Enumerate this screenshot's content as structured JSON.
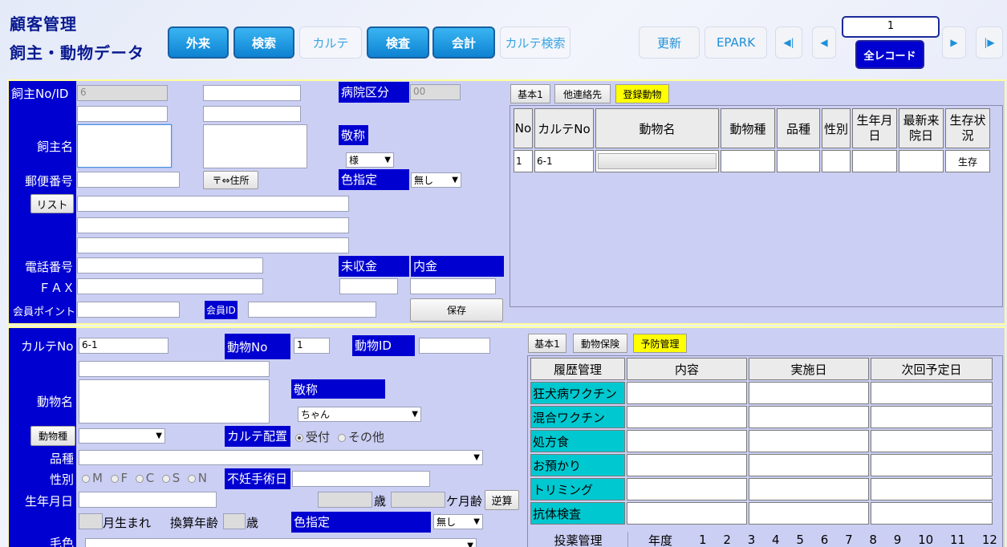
{
  "header": {
    "title1": "顧客管理",
    "title2": "飼主・動物データ"
  },
  "nav": [
    {
      "label": "外来",
      "style": "blue"
    },
    {
      "label": "検索",
      "style": "blue"
    },
    {
      "label": "カルテ",
      "style": "light"
    },
    {
      "label": "検査",
      "style": "blue"
    },
    {
      "label": "会計",
      "style": "blue"
    },
    {
      "label": "カルテ検索",
      "style": "light"
    }
  ],
  "topright": {
    "update": "更新",
    "epark": "EPARK",
    "first": "◀|",
    "prev": "◀",
    "record": "1",
    "next": "▶",
    "last": "|▶",
    "all_records": "全レコード"
  },
  "owner": {
    "labels": {
      "id": "飼主No/ID",
      "name": "飼主名",
      "zip": "郵便番号",
      "list": "リスト",
      "tel": "電話番号",
      "fax": "ＦＡＸ",
      "points": "会員ポイント",
      "member_id": "会員ID",
      "hospital": "病院区分",
      "title": "敬称",
      "color": "色指定",
      "unpaid": "未収金",
      "deposit": "内金",
      "zip_btn": "〒⇔住所",
      "save": "保存"
    },
    "values": {
      "id": "6",
      "hospital": "00",
      "title": "様",
      "color": "無し"
    },
    "tabs": [
      "基本1",
      "他連絡先",
      "登録動物"
    ],
    "animal_table": {
      "headers": [
        "No",
        "カルテNo",
        "動物名",
        "動物種",
        "品種",
        "性別",
        "生年月日",
        "最新来院日",
        "生存状況"
      ],
      "rows": [
        {
          "no": "1",
          "karte": "6-1",
          "name": "",
          "species": "",
          "breed": "",
          "sex": "",
          "birth": "",
          "last": "",
          "status": "生存"
        }
      ]
    }
  },
  "animal": {
    "labels": {
      "karte": "カルテNo",
      "animal_no": "動物No",
      "animal_id": "動物ID",
      "name": "動物名",
      "title": "敬称",
      "species_btn": "動物種",
      "karte_loc": "カルテ配置",
      "breed": "品種",
      "sex": "性別",
      "steril": "不妊手術日",
      "birth": "生年月日",
      "age_y": "歳",
      "age_m": "ケ月齢",
      "reverse": "逆算",
      "born_month": "月生まれ",
      "conv_age": "換算年齢",
      "conv_age_unit": "歳",
      "color": "色指定",
      "coat": "毛色"
    },
    "values": {
      "karte": "6-1",
      "animal_no": "1",
      "title": "ちゃん",
      "color": "無し"
    },
    "karte_loc_options": [
      "受付",
      "その他"
    ],
    "sex_options": [
      "M",
      "F",
      "C",
      "S",
      "N"
    ],
    "tabs": [
      "基本1",
      "動物保険",
      "予防管理"
    ],
    "prevention": {
      "headers": [
        "履歴管理",
        "内容",
        "実施日",
        "次回予定日"
      ],
      "rows": [
        "狂犬病ワクチン",
        "混合ワクチン",
        "処方食",
        "お預かり",
        "トリミング",
        "抗体検査"
      ]
    },
    "dosage": {
      "label": "投薬管理",
      "year": "年度",
      "months": [
        "1",
        "2",
        "3",
        "4",
        "5",
        "6",
        "7",
        "8",
        "9",
        "10",
        "11",
        "12"
      ]
    }
  }
}
